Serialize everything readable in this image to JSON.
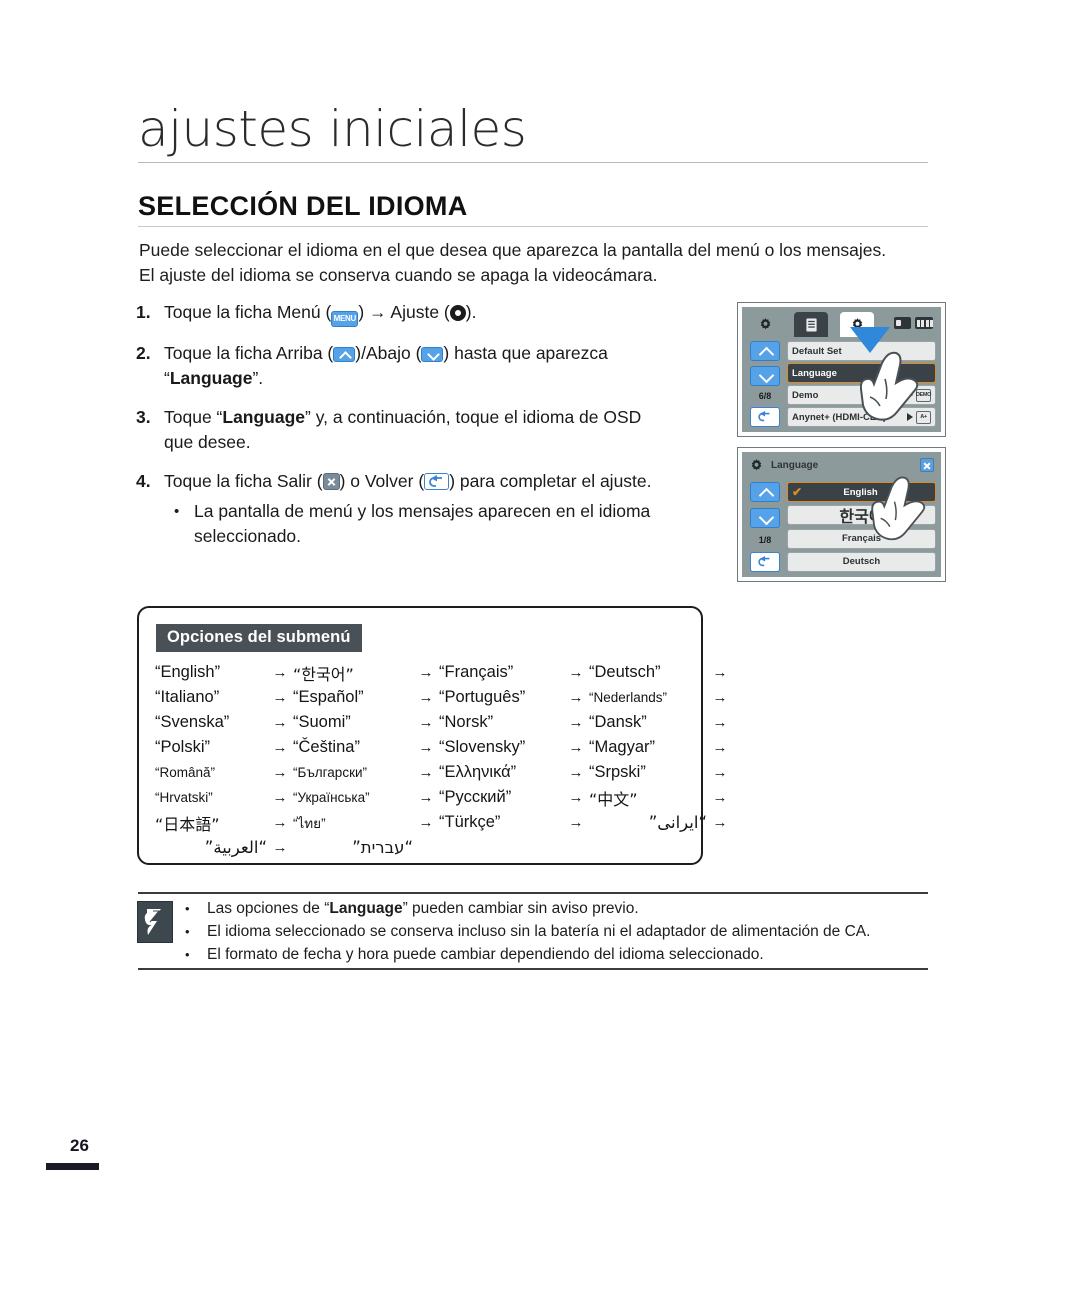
{
  "document": {
    "chapter_title": "ajustes iniciales",
    "section_title": "SELECCIÓN DEL IDIOMA",
    "page_number": "26"
  },
  "intro": {
    "line1": "Puede seleccionar el idioma en el que desea que aparezca la pantalla del menú o los mensajes.",
    "line2": "El ajuste del idioma se conserva cuando se apaga la videocámara."
  },
  "steps": [
    {
      "num": "1.",
      "text_a": "Toque la ficha Menú (",
      "icon_a": "menu-icon",
      "text_b": ") ",
      "arrow": "→",
      "text_c": " Ajuste (",
      "icon_b": "gear-icon",
      "text_d": ")."
    },
    {
      "num": "2.",
      "text_a": "Toque la ficha Arriba (",
      "icon_a": "up-arrow-icon",
      "text_b": ")/Abajo (",
      "icon_b": "down-arrow-icon",
      "text_c": ") hasta que aparezca",
      "text_d": "“",
      "bold": "Language",
      "text_e": "”."
    },
    {
      "num": "3.",
      "text_a": "Toque “",
      "bold": "Language",
      "text_b": "” y, a continuación, toque el idioma de OSD",
      "text_c": "que desee."
    },
    {
      "num": "4.",
      "text_a": "Toque la ficha Salir (",
      "icon_a": "exit-icon",
      "text_b": ") o Volver (",
      "icon_b": "return-icon",
      "text_c": ") para completar el ajuste.",
      "bullet": "La pantalla de menú y los mensajes aparecen en el idioma seleccionado."
    }
  ],
  "screens": {
    "menu_screen": {
      "name": "settings-menu-screen",
      "page_indicator": "6/8",
      "rows": [
        {
          "label": "Default Set",
          "selected": false,
          "has_play": false,
          "badge": ""
        },
        {
          "label": "Language",
          "selected": true,
          "has_play": false,
          "badge": ""
        },
        {
          "label": "Demo",
          "selected": false,
          "has_play": true,
          "badge": "DEMO"
        },
        {
          "label": "Anynet+ (HDMI-CEC)",
          "selected": false,
          "has_play": true,
          "badge": "A+"
        }
      ]
    },
    "language_screen": {
      "name": "language-submenu-screen",
      "title": "Language",
      "page_indicator": "1/8",
      "rows": [
        {
          "label": "English",
          "selected": true
        },
        {
          "label": "한국어",
          "selected": false
        },
        {
          "label": "Français",
          "selected": false
        },
        {
          "label": "Deutsch",
          "selected": false
        }
      ]
    }
  },
  "submenu": {
    "label": "Opciones del submenú",
    "rows": [
      [
        "“English”",
        "→",
        "“한국어”",
        "→",
        "“Français”",
        "→",
        "“Deutsch”",
        "→"
      ],
      [
        "“Italiano”",
        "→",
        "“Español”",
        "→",
        "“Português”",
        "→",
        "“Nederlands”",
        "→"
      ],
      [
        "“Svenska”",
        "→",
        "“Suomi”",
        "→",
        "“Norsk”",
        "→",
        "“Dansk”",
        "→"
      ],
      [
        "“Polski”",
        "→",
        "“Čeština”",
        "→",
        "“Slovensky”",
        "→",
        "“Magyar”",
        "→"
      ],
      [
        "“Română”",
        "→",
        "“Български”",
        "→",
        "“Ελληνικά”",
        "→",
        "“Srpski”",
        "→"
      ],
      [
        "“Hrvatski”",
        "→",
        "“Українська”",
        "→",
        "“Русский”",
        "→",
        "“中文”",
        "→"
      ],
      [
        "“日本語”",
        "→",
        "“ไทย”",
        "→",
        "“Türkçe”",
        "→",
        "“ایرانی”",
        "→"
      ],
      [
        "“العربية”",
        "→",
        "“עברית”",
        "",
        "",
        "",
        "",
        ""
      ]
    ]
  },
  "notes": [
    {
      "prefix": "Las opciones de “",
      "bold": "Language",
      "suffix": "” pueden cambiar sin aviso previo."
    },
    {
      "prefix": "El idioma seleccionado se conserva incluso sin la batería ni el adaptador de alimentación de CA.",
      "bold": "",
      "suffix": ""
    },
    {
      "prefix": "El formato de fecha y hora puede cambiar dependiendo del idioma seleccionado.",
      "bold": "",
      "suffix": ""
    }
  ],
  "colors": {
    "accent_blue": "#56a2e8",
    "selected_orange": "#e08a22",
    "screen_bg": "#8c9a9c",
    "dark_row": "#3a4247"
  }
}
